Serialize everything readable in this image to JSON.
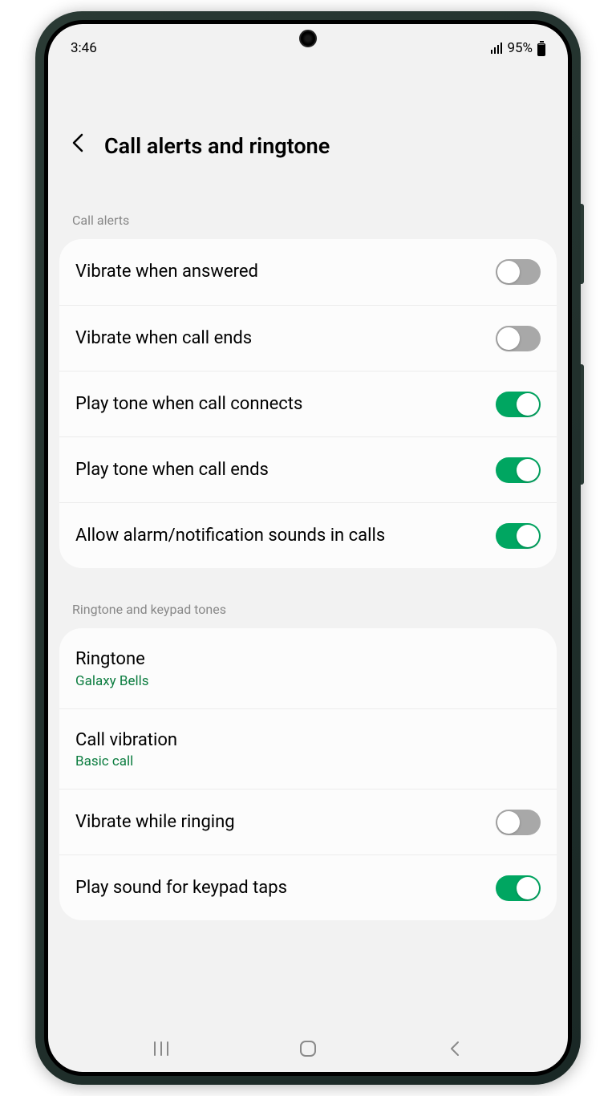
{
  "status": {
    "time": "3:46",
    "battery": "95%"
  },
  "header": {
    "title": "Call alerts and ringtone"
  },
  "section1": {
    "title": "Call alerts",
    "items": [
      {
        "label": "Vibrate when answered",
        "on": false
      },
      {
        "label": "Vibrate when call ends",
        "on": false
      },
      {
        "label": "Play tone when call connects",
        "on": true
      },
      {
        "label": "Play tone when call ends",
        "on": true
      },
      {
        "label": "Allow alarm/notification sounds in calls",
        "on": true
      }
    ]
  },
  "section2": {
    "title": "Ringtone and keypad tones",
    "items": [
      {
        "label": "Ringtone",
        "value": "Galaxy Bells"
      },
      {
        "label": "Call vibration",
        "value": "Basic call"
      },
      {
        "label": "Vibrate while ringing",
        "on": false
      },
      {
        "label": "Play sound for keypad taps",
        "on": true
      }
    ]
  }
}
